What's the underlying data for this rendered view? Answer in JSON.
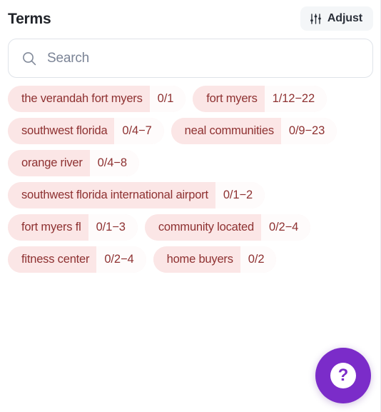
{
  "header": {
    "title": "Terms",
    "adjust_label": "Adjust",
    "adjust_icon": "sliders-icon"
  },
  "search": {
    "placeholder": "Search",
    "value": "",
    "icon": "search-icon"
  },
  "terms": [
    {
      "label": "the verandah fort myers",
      "count": "0/1"
    },
    {
      "label": "fort myers",
      "count": "1/12−22"
    },
    {
      "label": "southwest florida",
      "count": "0/4−7"
    },
    {
      "label": "neal communities",
      "count": "0/9−23"
    },
    {
      "label": "orange river",
      "count": "0/4−8"
    },
    {
      "label": "southwest florida international airport",
      "count": "0/1−2"
    },
    {
      "label": "fort myers fl",
      "count": "0/1−3"
    },
    {
      "label": "community located",
      "count": "0/2−4"
    },
    {
      "label": "fitness center",
      "count": "0/2−4"
    },
    {
      "label": "home buyers",
      "count": "0/2"
    }
  ],
  "help": {
    "glyph": "?",
    "icon": "question-mark-icon"
  },
  "colors": {
    "chip_label_bg": "#FBE6E6",
    "chip_count_bg": "#FEFBFB",
    "chip_text": "#8E3131",
    "accent_purple": "#7B2CC9",
    "title_text": "#22252B",
    "adjust_bg": "#F4F6F8"
  }
}
